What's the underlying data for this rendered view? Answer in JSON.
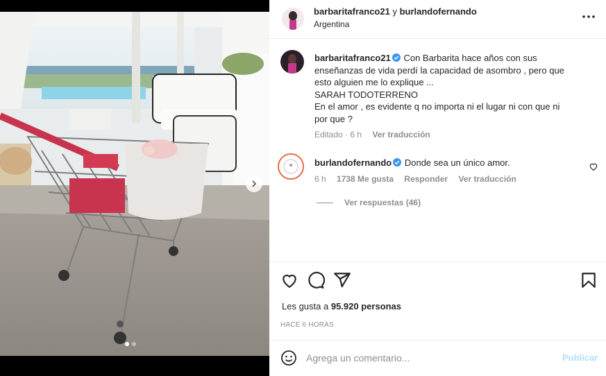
{
  "header": {
    "user1": "barbaritafranco21",
    "separator": "y",
    "user2": "burlandofernando",
    "location": "Argentina"
  },
  "caption": {
    "username": "barbaritafranco21",
    "lines": [
      "Con Barbarita hace años con sus",
      "enseñanzas de vida perdí la capacidad de asombro , pero que",
      "esto alguien me lo explique ...",
      "SARAH TODOTERRENO",
      "En el amor , es evidente q no importa ni el lugar ni con que ni",
      "por que ?"
    ],
    "edited": "Editado · 6 h",
    "see_translation": "Ver traducción"
  },
  "comment": {
    "username": "burlandofernando",
    "text": "Donde sea un único amor.",
    "time": "6 h",
    "likes": "1738 Me gusta",
    "reply": "Responder",
    "see_translation": "Ver traducción",
    "view_replies": "Ver respuestas (46)"
  },
  "post": {
    "likes_prefix": "Les gusta a",
    "likes_count": "95.920 personas",
    "time_ago": "HACE 6 HORAS"
  },
  "comment_box": {
    "placeholder": "Agrega un comentario...",
    "publish": "Publicar"
  },
  "carousel": {
    "total_slides": 2,
    "active_slide": 1
  },
  "icons": [
    "more-icon",
    "verified-icon",
    "heart-icon",
    "comment-icon",
    "share-icon",
    "bookmark-icon",
    "emoji-icon",
    "chevron-right-icon"
  ],
  "colors": {
    "verified": "#3897f0",
    "link_disabled": "#b2dffc",
    "muted": "#8e8e8e",
    "text": "#262626"
  }
}
